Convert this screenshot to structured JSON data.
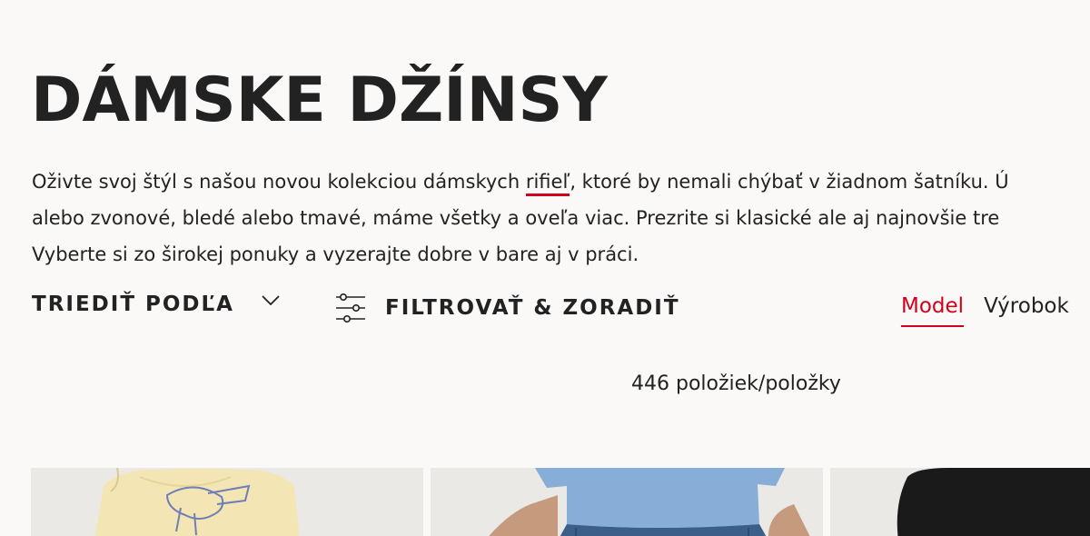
{
  "page": {
    "title": "DÁMSKE DŽÍNSY",
    "description": {
      "line1_before": "Oživte svoj štýl s našou novou kolekciou dámskych ",
      "line1_link": "rifieľ",
      "line1_after": ", ktoré by nemali chýbať v žiadnom šatníku. Ú",
      "line2": "alebo zvonové, bledé alebo tmavé, máme všetky a oveľa viac. Prezrite si klasické ale aj najnovšie tre",
      "line3": "Vyberte si zo širokej ponuky a vyzerajte dobre v bare aj v práci."
    }
  },
  "toolbar": {
    "sort_label": "TRIEDIŤ PODĽA",
    "sort_icon": "chevron-down-icon",
    "filter_label": "FILTROVAŤ & ZORADIŤ",
    "filter_icon": "sliders-icon",
    "view_toggle": {
      "options": [
        "Model",
        "Výrobok"
      ],
      "active": "Model"
    }
  },
  "results": {
    "count_text": "446 položiek/položky"
  },
  "colors": {
    "accent": "#d0021b",
    "text": "#222222",
    "background": "#faf9f8"
  }
}
